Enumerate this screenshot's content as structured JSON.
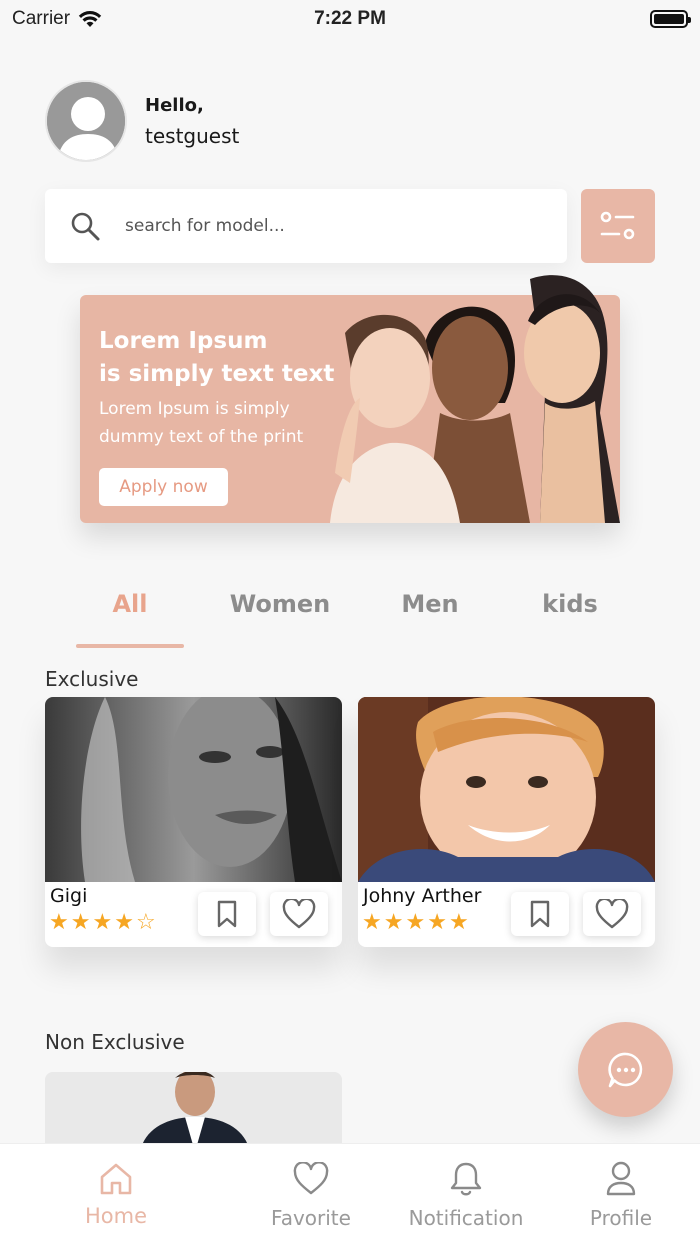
{
  "status_bar": {
    "carrier": "Carrier",
    "time": "7:22 PM"
  },
  "header": {
    "hello": "Hello,",
    "username": "testguest"
  },
  "search": {
    "placeholder": "search for model..."
  },
  "banner": {
    "title_line1": "Lorem Ipsum",
    "title_line2": "is simply text text",
    "subtitle": "Lorem Ipsum is simply dummy text of the print",
    "button": "Apply now"
  },
  "tabs": [
    {
      "label": "All",
      "active": true
    },
    {
      "label": "Women",
      "active": false
    },
    {
      "label": "Men",
      "active": false
    },
    {
      "label": "kids",
      "active": false
    }
  ],
  "sections": {
    "exclusive": "Exclusive",
    "non_exclusive": "Non Exclusive"
  },
  "exclusive_cards": [
    {
      "name": "Gigi",
      "rating": 4,
      "max_rating": 5
    },
    {
      "name": "Johny Arther",
      "rating": 5,
      "max_rating": 5
    }
  ],
  "bottom_nav": [
    {
      "label": "Home",
      "icon": "home-icon",
      "active": true
    },
    {
      "label": "Favorite",
      "icon": "heart-icon",
      "active": false
    },
    {
      "label": "Notification",
      "icon": "bell-icon",
      "active": false
    },
    {
      "label": "Profile",
      "icon": "user-icon",
      "active": false
    }
  ],
  "colors": {
    "accent": "#e8b7a6",
    "accent_text": "#e8a48c",
    "star": "#f6a623"
  }
}
